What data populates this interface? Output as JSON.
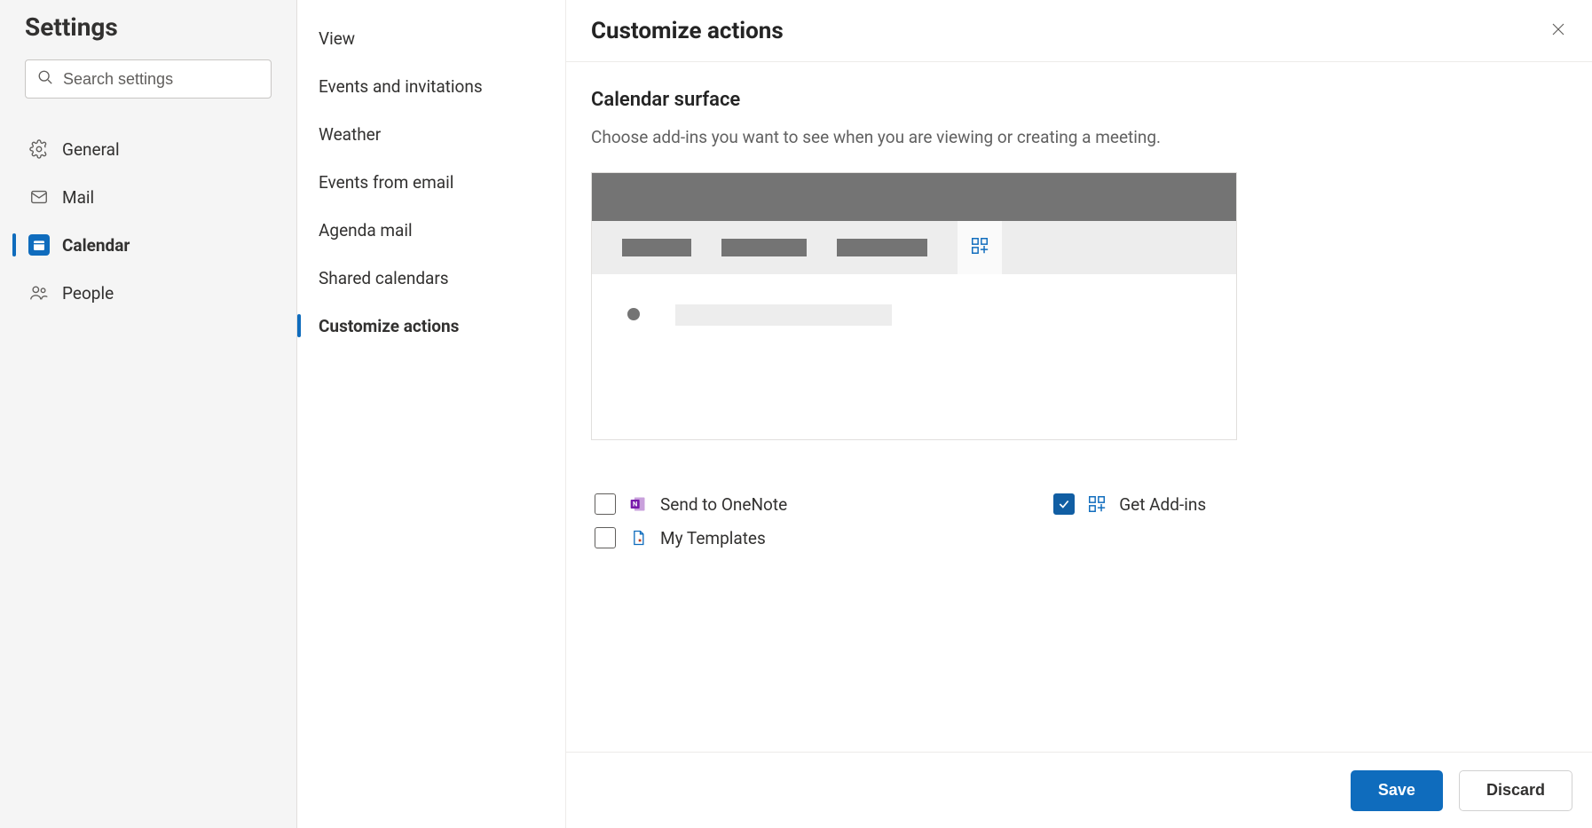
{
  "settings_title": "Settings",
  "search": {
    "placeholder": "Search settings"
  },
  "categories": [
    {
      "key": "general",
      "label": "General",
      "selected": false
    },
    {
      "key": "mail",
      "label": "Mail",
      "selected": false
    },
    {
      "key": "calendar",
      "label": "Calendar",
      "selected": true
    },
    {
      "key": "people",
      "label": "People",
      "selected": false
    }
  ],
  "submenu": [
    {
      "key": "view",
      "label": "View",
      "selected": false
    },
    {
      "key": "events-invites",
      "label": "Events and invitations",
      "selected": false
    },
    {
      "key": "weather",
      "label": "Weather",
      "selected": false
    },
    {
      "key": "events-email",
      "label": "Events from email",
      "selected": false
    },
    {
      "key": "agenda-mail",
      "label": "Agenda mail",
      "selected": false
    },
    {
      "key": "shared-cal",
      "label": "Shared calendars",
      "selected": false
    },
    {
      "key": "customize",
      "label": "Customize actions",
      "selected": true
    }
  ],
  "page": {
    "title": "Customize actions",
    "section_title": "Calendar surface",
    "section_desc": "Choose add-ins you want to see when you are viewing or creating a meeting."
  },
  "addins": [
    {
      "key": "onenote",
      "label": "Send to OneNote",
      "checked": false
    },
    {
      "key": "templates",
      "label": "My Templates",
      "checked": false
    },
    {
      "key": "getaddins",
      "label": "Get Add-ins",
      "checked": true
    }
  ],
  "buttons": {
    "save": "Save",
    "discard": "Discard"
  },
  "colors": {
    "accent": "#0f6cbd",
    "accent_dark": "#115ea3"
  }
}
